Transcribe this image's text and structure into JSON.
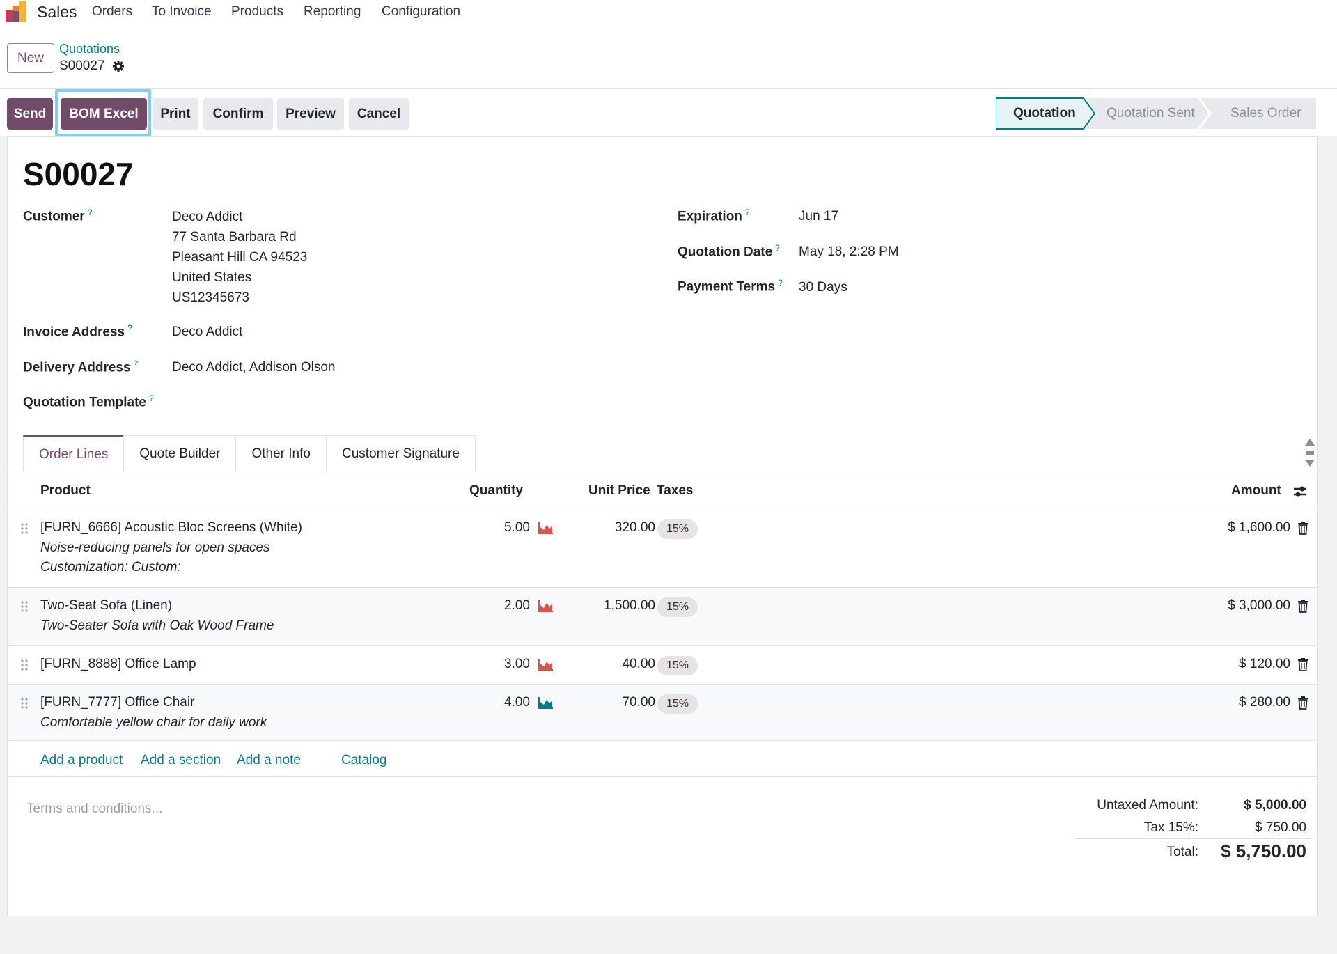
{
  "nav": {
    "app_name": "Sales",
    "menu": [
      "Orders",
      "To Invoice",
      "Products",
      "Reporting",
      "Configuration"
    ]
  },
  "control_panel": {
    "new_label": "New",
    "breadcrumb_parent": "Quotations",
    "breadcrumb_current": "S00027"
  },
  "actions": {
    "send": "Send",
    "bom_excel": "BOM Excel",
    "print": "Print",
    "confirm": "Confirm",
    "preview": "Preview",
    "cancel": "Cancel"
  },
  "statusbar": {
    "stages": [
      "Quotation",
      "Quotation Sent",
      "Sales Order"
    ],
    "active": "Quotation"
  },
  "record": {
    "name": "S00027",
    "customer_label": "Customer",
    "customer_lines": [
      "Deco Addict",
      "77 Santa Barbara Rd",
      "Pleasant Hill CA 94523",
      "United States",
      "US12345673"
    ],
    "invoice_address_label": "Invoice Address",
    "invoice_address": "Deco Addict",
    "delivery_address_label": "Delivery Address",
    "delivery_address": "Deco Addict, Addison Olson",
    "quotation_template_label": "Quotation Template",
    "expiration_label": "Expiration",
    "expiration": "Jun 17",
    "quotation_date_label": "Quotation Date",
    "quotation_date": "May 18, 2:28 PM",
    "payment_terms_label": "Payment Terms",
    "payment_terms": "30 Days"
  },
  "tabs": [
    "Order Lines",
    "Quote Builder",
    "Other Info",
    "Customer Signature"
  ],
  "table": {
    "headers": {
      "product": "Product",
      "quantity": "Quantity",
      "unit_price": "Unit Price",
      "taxes": "Taxes",
      "amount": "Amount"
    },
    "rows": [
      {
        "product": "[FURN_6666] Acoustic Bloc Screens (White)",
        "desc1": "Noise-reducing panels for open spaces",
        "desc2": "Customization: Custom:",
        "qty": "5.00",
        "price": "320.00",
        "tax": "15%",
        "amount": "$ 1,600.00",
        "forecast_color": "#d9534f"
      },
      {
        "product": "Two-Seat Sofa (Linen)",
        "desc1": "Two-Seater Sofa with Oak Wood Frame",
        "desc2": "",
        "qty": "2.00",
        "price": "1,500.00",
        "tax": "15%",
        "amount": "$ 3,000.00",
        "forecast_color": "#d9534f"
      },
      {
        "product": "[FURN_8888] Office Lamp",
        "desc1": "",
        "desc2": "",
        "qty": "3.00",
        "price": "40.00",
        "tax": "15%",
        "amount": "$ 120.00",
        "forecast_color": "#d9534f"
      },
      {
        "product": "[FURN_7777] Office Chair",
        "desc1": "Comfortable yellow chair for daily work",
        "desc2": "",
        "qty": "4.00",
        "price": "70.00",
        "tax": "15%",
        "amount": "$ 280.00",
        "forecast_color": "#017e84"
      }
    ],
    "links": [
      "Add a product",
      "Add a section",
      "Add a note",
      "Catalog"
    ]
  },
  "footer": {
    "terms_placeholder": "Terms and conditions...",
    "untaxed_label": "Untaxed Amount:",
    "untaxed_value": "$ 5,000.00",
    "tax_label": "Tax 15%:",
    "tax_value": "$ 750.00",
    "total_label": "Total:",
    "total_value": "$ 5,750.00"
  },
  "colors": {
    "brand": "#714b67",
    "link": "#017e84",
    "highlight": "#7fd0f2"
  }
}
